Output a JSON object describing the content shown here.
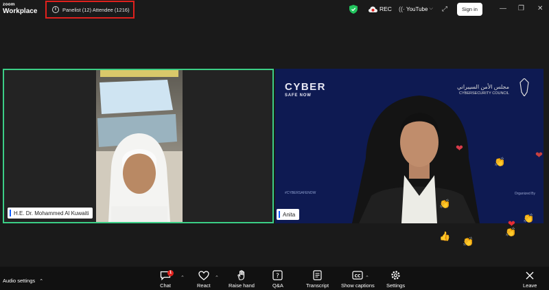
{
  "app": {
    "logo_line1": "zoom",
    "logo_line2": "Workplace"
  },
  "header": {
    "participants_text": "Panelist (12) Attendee (1216)",
    "rec_label": "REC",
    "stream_label": "YouTube",
    "signin_label": "Sign in"
  },
  "participants": [
    {
      "name": "H.E. Dr. Mohammed Al Kuwaiti"
    },
    {
      "name": "Anita"
    }
  ],
  "background": {
    "logo_main": "CYBER",
    "logo_sub": "SAFE NOW",
    "council_arabic": "مجلس الأمن السيبراني",
    "council_english": "CYBERSECURITY COUNCIL",
    "hashtag": "#CYBERSAFENOW",
    "organized_by": "Organized By"
  },
  "toolbar": {
    "audio_settings": "Audio settings",
    "chat": "Chat",
    "chat_badge": "1",
    "react": "React",
    "raise_hand": "Raise hand",
    "qa": "Q&A",
    "transcript": "Transcript",
    "show_captions": "Show captions",
    "settings": "Settings",
    "leave": "Leave"
  },
  "colors": {
    "active_speaker_border": "#3bcf86",
    "highlight_box": "#e0211d",
    "accent": "#0b5cff",
    "badge": "#e0211d"
  }
}
